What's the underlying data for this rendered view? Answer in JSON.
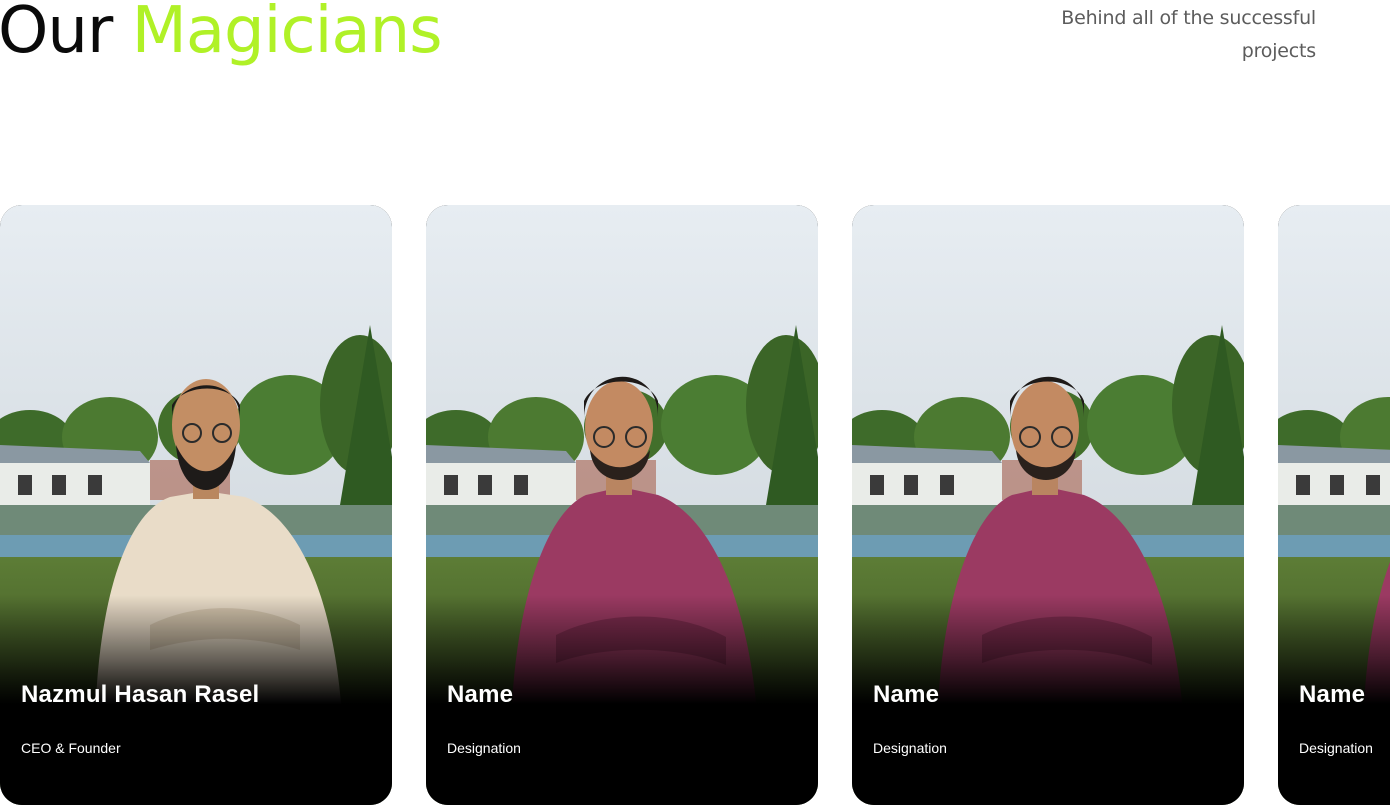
{
  "section": {
    "title_prefix": "Our",
    "title_highlight": "Magicians",
    "tagline": "Behind  all of the successful projects",
    "accent_color": "#b0f127"
  },
  "team": [
    {
      "name": "Nazmul Hasan Rasel",
      "role": "CEO & Founder",
      "shirt_color": "#e9dcc8"
    },
    {
      "name": "Name",
      "role": "Designation",
      "shirt_color": "#9b3a62"
    },
    {
      "name": "Name",
      "role": "Designation",
      "shirt_color": "#9b3a62"
    },
    {
      "name": "Name",
      "role": "Designation",
      "shirt_color": "#9b3a62"
    }
  ]
}
